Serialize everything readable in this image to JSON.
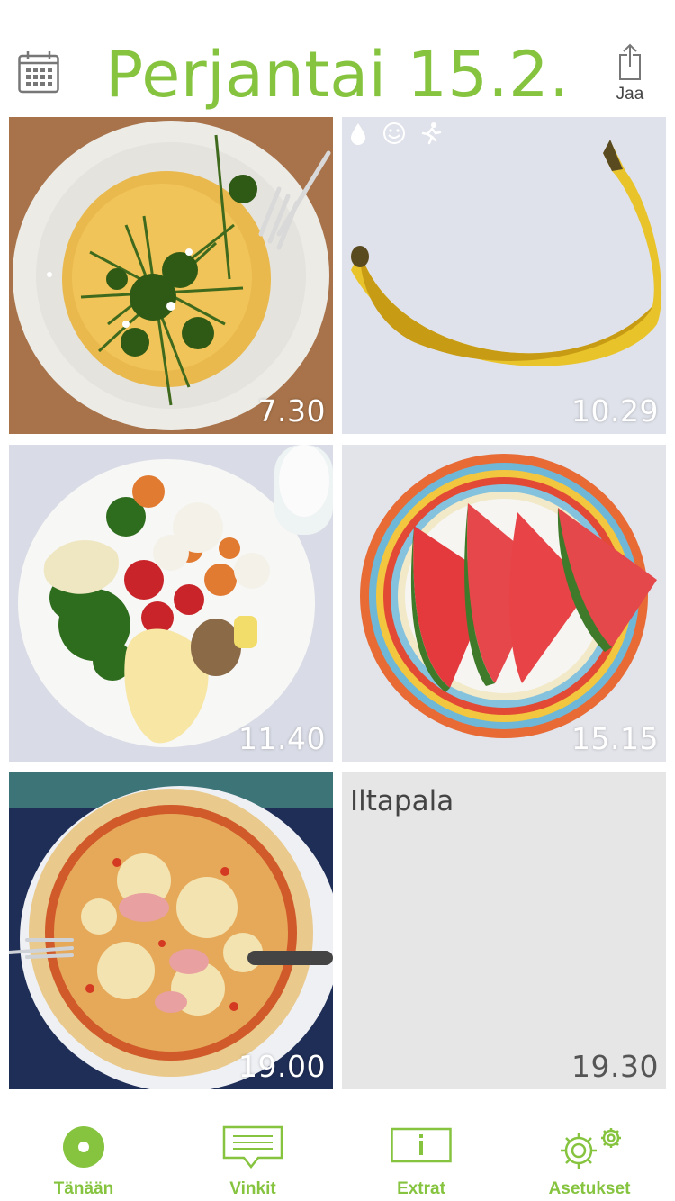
{
  "header": {
    "title": "Perjantai 15.2.",
    "share_label": "Jaa",
    "accent_color": "#86c440",
    "calendar_icon": "calendar-icon",
    "share_icon": "share-icon"
  },
  "meals": [
    {
      "time": "7.30",
      "photo": "omelette-with-herbs"
    },
    {
      "time": "10.29",
      "photo": "banana",
      "status_icons": [
        "water-drop-icon",
        "smiley-icon",
        "running-person-icon"
      ]
    },
    {
      "time": "11.40",
      "photo": "plate-of-vegetables-and-mashed-potatoes"
    },
    {
      "time": "15.15",
      "photo": "watermelon-slices"
    },
    {
      "time": "19.00",
      "photo": "pizza"
    },
    {
      "time": "19.30",
      "label": "Iltapala",
      "photo": null
    }
  ],
  "tabbar": {
    "tabs": [
      {
        "label": "Tänään",
        "icon": "today-dot-icon",
        "active": true
      },
      {
        "label": "Vinkit",
        "icon": "speech-bubble-icon",
        "active": false
      },
      {
        "label": "Extrat",
        "icon": "info-icon",
        "active": false
      },
      {
        "label": "Asetukset",
        "icon": "gears-icon",
        "active": false
      }
    ]
  }
}
